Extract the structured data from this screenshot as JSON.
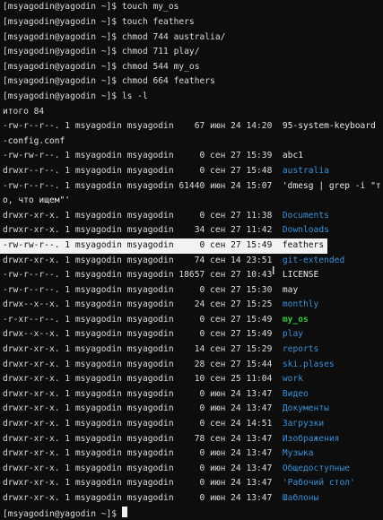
{
  "terminal": {
    "commands": [
      "[msyagodin@yagodin ~]$ touch my_os",
      "[msyagodin@yagodin ~]$ touch feathers",
      "[msyagodin@yagodin ~]$ chmod 744 australia/",
      "[msyagodin@yagodin ~]$ chmod 711 play/",
      "[msyagodin@yagodin ~]$ chmod 544 my_os",
      "[msyagodin@yagodin ~]$ chmod 664 feathers",
      "[msyagodin@yagodin ~]$ ls -l"
    ],
    "total": "итого 84",
    "listing": [
      {
        "meta": "-rw-r--r--. 1 msyagodin msyagodin    67 июн 24 14:20  ",
        "name": "95-system-keyboard",
        "color": "white"
      },
      {
        "meta": "",
        "name": "-config.conf",
        "color": "white"
      },
      {
        "meta": "-rw-rw-r--. 1 msyagodin msyagodin     0 сен 27 15:39  ",
        "name": "abc1",
        "color": "white"
      },
      {
        "meta": "drwxr--r--. 1 msyagodin msyagodin     0 сен 27 15:48  ",
        "name": "australia",
        "color": "blue"
      },
      {
        "meta": "-rw-r--r--. 1 msyagodin msyagodin 61440 июн 24 15:07  ",
        "name": "'dmesg | grep -i \"т",
        "color": "white"
      },
      {
        "meta": "",
        "name": "о, что ищем\"'",
        "color": "white"
      },
      {
        "meta": "drwxr-xr-x. 1 msyagodin msyagodin     0 сен 27 11:38  ",
        "name": "Documents",
        "color": "blue"
      },
      {
        "meta": "drwxr-xr-x. 1 msyagodin msyagodin    34 сен 27 11:42  ",
        "name": "Downloads",
        "color": "blue"
      },
      {
        "meta": "-rw-rw-r--. 1 msyagodin msyagodin     0 сен 27 15:49  ",
        "name": "feathers",
        "color": "white",
        "highlight": true
      },
      {
        "meta": "drwxr-xr-x. 1 msyagodin msyagodin    74 сен 14 23:51  ",
        "name": "git-extended",
        "color": "blue"
      },
      {
        "meta": "-rw-r--r--. 1 msyagodin msyagodin 18657 сен 27 10:43  ",
        "name": "LICENSE",
        "color": "white"
      },
      {
        "meta": "-rw-r--r--. 1 msyagodin msyagodin     0 сен 27 15:30  ",
        "name": "may",
        "color": "white"
      },
      {
        "meta": "drwx--x--x. 1 msyagodin msyagodin    24 сен 27 15:25  ",
        "name": "monthly",
        "color": "blue"
      },
      {
        "meta": "-r-xr--r--. 1 msyagodin msyagodin     0 сен 27 15:49  ",
        "name": "my_os",
        "color": "green"
      },
      {
        "meta": "drwx--x--x. 1 msyagodin msyagodin     0 сен 27 15:49  ",
        "name": "play",
        "color": "blue"
      },
      {
        "meta": "drwxr-xr-x. 1 msyagodin msyagodin    14 сен 27 15:29  ",
        "name": "reports",
        "color": "blue"
      },
      {
        "meta": "drwxr-xr-x. 1 msyagodin msyagodin    28 сен 27 15:44  ",
        "name": "ski.plases",
        "color": "blue"
      },
      {
        "meta": "drwxr-xr-x. 1 msyagodin msyagodin    10 сен 25 11:04  ",
        "name": "work",
        "color": "blue"
      },
      {
        "meta": "drwxr-xr-x. 1 msyagodin msyagodin     0 июн 24 13:47  ",
        "name": "Видео",
        "color": "blue"
      },
      {
        "meta": "drwxr-xr-x. 1 msyagodin msyagodin     0 июн 24 13:47  ",
        "name": "Документы",
        "color": "blue"
      },
      {
        "meta": "drwxr-xr-x. 1 msyagodin msyagodin     0 сен 24 14:51  ",
        "name": "Загрузки",
        "color": "blue"
      },
      {
        "meta": "drwxr-xr-x. 1 msyagodin msyagodin    78 сен 24 13:47  ",
        "name": "Изображения",
        "color": "blue"
      },
      {
        "meta": "drwxr-xr-x. 1 msyagodin msyagodin     0 июн 24 13:47  ",
        "name": "Музыка",
        "color": "blue"
      },
      {
        "meta": "drwxr-xr-x. 1 msyagodin msyagodin     0 июн 24 13:47  ",
        "name": "Общедоступные",
        "color": "blue"
      },
      {
        "meta": "drwxr-xr-x. 1 msyagodin msyagodin     0 июн 24 13:47  ",
        "name": "'Рабочий стол'",
        "color": "blue"
      },
      {
        "meta": "drwxr-xr-x. 1 msyagodin msyagodin     0 июн 24 13:47  ",
        "name": "Шаблоны",
        "color": "blue"
      }
    ],
    "prompt": "[msyagodin@yagodin ~]$ "
  },
  "colors": {
    "background": "#0d0d0d",
    "text": "#dcdcdc",
    "directory": "#3d8fd6",
    "executable": "#35c93d",
    "highlight_bg": "#f2f2f2"
  },
  "icons": {
    "cursor": "block-cursor",
    "mouse": "mouse-pointer-icon"
  }
}
